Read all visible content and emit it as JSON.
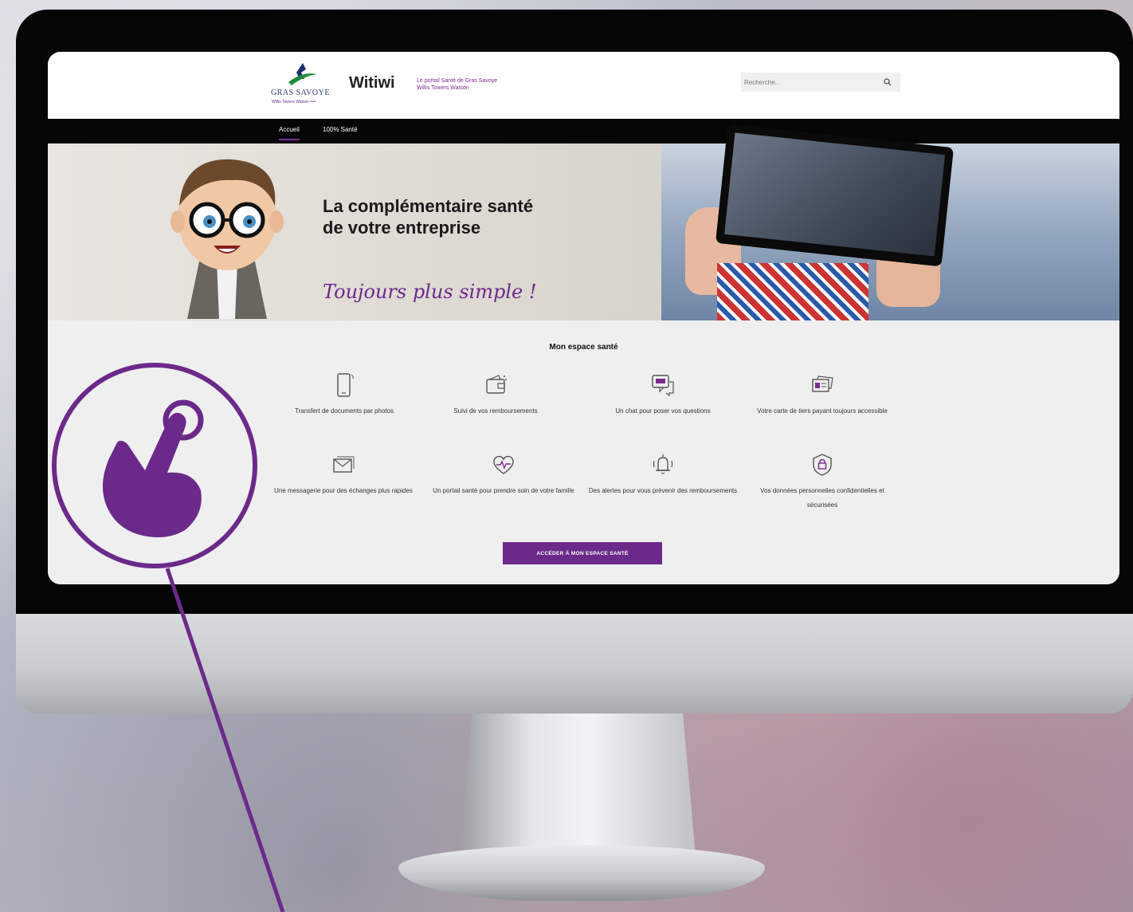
{
  "header": {
    "logo_name": "GRAS SAVOYE",
    "logo_sub": "Willis Towers Watson ••••",
    "brand": "Witiwi",
    "tagline_line1": "Le portail Santé de Gras Savoye",
    "tagline_line2": "Willis Towers Watson",
    "search_placeholder": "Recherche..."
  },
  "nav": {
    "items": [
      {
        "label": "Accueil",
        "active": true
      },
      {
        "label": "100% Santé",
        "active": false
      }
    ]
  },
  "hero": {
    "title_line1": "La complémentaire santé",
    "title_line2": "de votre entreprise",
    "slogan": "Toujours plus simple !"
  },
  "features": {
    "title": "Mon espace santé",
    "items": [
      {
        "icon": "smartphone-icon",
        "label": "Transfert de documents par photos"
      },
      {
        "icon": "wallet-icon",
        "label": "Suivi de vos remboursements"
      },
      {
        "icon": "chat-icon",
        "label": "Un chat pour poser vos questions"
      },
      {
        "icon": "card-icon",
        "label": "Votre carte de tiers payant toujours accessible"
      },
      {
        "icon": "envelope-icon",
        "label": "Une messagerie pour des échanges plus rapides"
      },
      {
        "icon": "heart-pulse-icon",
        "label": "Un portail santé pour prendre soin de votre famille"
      },
      {
        "icon": "bell-icon",
        "label": "Des alertes pour vous prévenir des remboursements"
      },
      {
        "icon": "shield-lock-icon",
        "label": "Vos données personnelles confidentielles et sécurisées"
      }
    ],
    "cta_label": "ACCÉDER À MON ESPACE SANTÉ"
  },
  "colors": {
    "accent": "#6b2a8a",
    "nav_bg": "#050505",
    "feature_bg": "#efefef"
  }
}
